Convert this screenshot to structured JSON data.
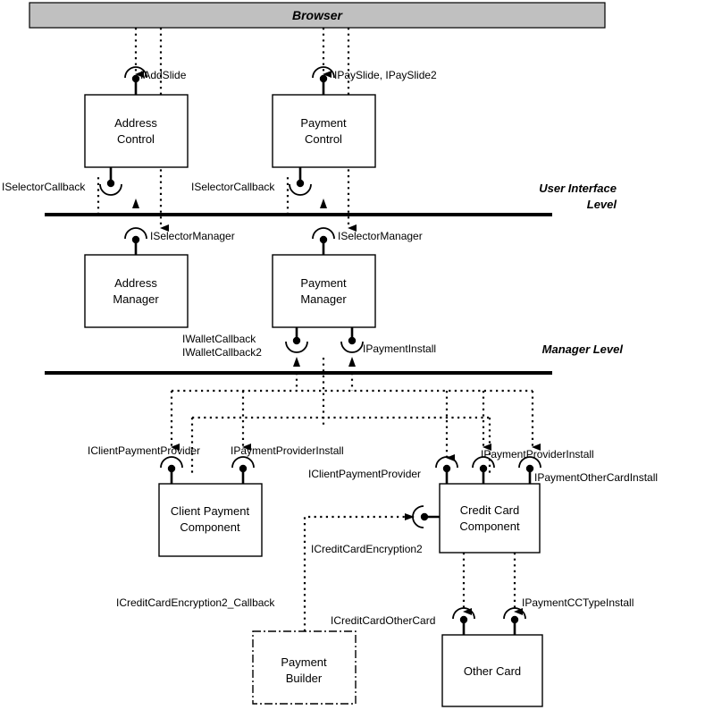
{
  "diagram": {
    "title": "Browser",
    "header": {
      "label": "Browser"
    },
    "lanes": [
      {
        "id": "ui-level",
        "line1": "User Interface",
        "line2": "Level"
      },
      {
        "id": "manager-level",
        "line1": "Manager Level",
        "line2": ""
      }
    ],
    "boxes": [
      {
        "id": "address-control",
        "line1": "Address",
        "line2": "Control",
        "style": "solid"
      },
      {
        "id": "payment-control",
        "line1": "Payment",
        "line2": "Control",
        "style": "solid"
      },
      {
        "id": "address-manager",
        "line1": "Address",
        "line2": "Manager",
        "style": "solid"
      },
      {
        "id": "payment-manager",
        "line1": "Payment",
        "line2": "Manager",
        "style": "solid"
      },
      {
        "id": "client-payment-component",
        "line1": "Client Payment",
        "line2": "Component",
        "style": "solid"
      },
      {
        "id": "credit-card-component",
        "line1": "Credit Card",
        "line2": "Component",
        "style": "solid"
      },
      {
        "id": "payment-builder",
        "line1": "Payment",
        "line2": "Builder",
        "style": "dashdot"
      },
      {
        "id": "other-card",
        "line1": "Other Card",
        "line2": "",
        "style": "solid"
      }
    ],
    "interfaces": [
      {
        "id": "iaddslide",
        "label": "IAddSlide"
      },
      {
        "id": "ipayslide",
        "label": "IPaySlide, IPaySlide2"
      },
      {
        "id": "iselectorcallback-address",
        "label": "ISelectorCallback"
      },
      {
        "id": "iselectorcallback-payment",
        "label": "ISelectorCallback"
      },
      {
        "id": "iselectormanager-address",
        "label": "ISelectorManager"
      },
      {
        "id": "iselectormanager-payment",
        "label": "ISelectorManager"
      },
      {
        "id": "iwalletcallback",
        "label": "IWalletCallback"
      },
      {
        "id": "iwalletcallback2",
        "label": "IWalletCallback2"
      },
      {
        "id": "ipaymentinstall",
        "label": "IPaymentInstall"
      },
      {
        "id": "iclientpaymentprovider-client",
        "label": "IClientPaymentProvider"
      },
      {
        "id": "ipaymentproviderinstall-client",
        "label": "IPaymentProviderInstall"
      },
      {
        "id": "iclientpaymentprovider-credit",
        "label": "IClientPaymentProvider"
      },
      {
        "id": "ipaymentproviderinstall-credit",
        "label": "IPaymentProviderInstall"
      },
      {
        "id": "ipaymentothercardinstall",
        "label": "IPaymentOtherCardInstall"
      },
      {
        "id": "icreditcardencryption2",
        "label": "ICreditCardEncryption2"
      },
      {
        "id": "icreditcardencryption2-callback",
        "label": "ICreditCardEncryption2_Callback"
      },
      {
        "id": "icreditcardothercard",
        "label": "ICreditCardOtherCard"
      },
      {
        "id": "ipaymentcctypeinstall",
        "label": "IPaymentCCTypeInstall"
      }
    ],
    "colors": {
      "header_fill": "#c0c0c0",
      "box_fill": "#ffffff",
      "stroke": "#000000",
      "background": "#ffffff"
    }
  }
}
